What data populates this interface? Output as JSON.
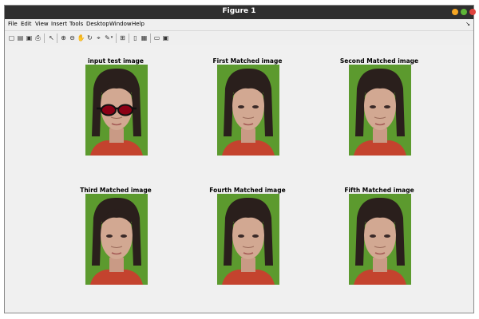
{
  "window": {
    "title": "Figure 1"
  },
  "menu": [
    "File",
    "Edit",
    "View",
    "Insert",
    "Tools",
    "Desktop",
    "Window",
    "Help"
  ],
  "toolbar_icons": [
    "new-figure-icon",
    "open-file-icon",
    "save-icon",
    "print-icon",
    "select-arrow-icon",
    "zoom-in-icon",
    "zoom-out-icon",
    "pan-icon",
    "rotate-3d-icon",
    "data-cursor-icon",
    "brush-icon",
    "link-plot-icon",
    "colorbar-icon",
    "legend-icon",
    "hide-plot-tools-icon",
    "show-plot-tools-icon"
  ],
  "panels": [
    {
      "title": "input test image"
    },
    {
      "title": "First Matched image"
    },
    {
      "title": "Second Matched image"
    },
    {
      "title": "Third Matched image"
    },
    {
      "title": "Fourth Matched image"
    },
    {
      "title": "Fifth Matched image"
    }
  ],
  "colors": {
    "background": "#5c9a2e",
    "glasses": "#8b0015",
    "titlebar": "#2f2f2f"
  }
}
